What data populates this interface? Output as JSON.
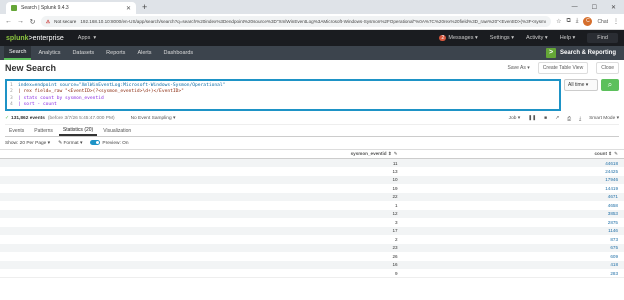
{
  "browser": {
    "tab_title": "Search | Splunk 9.4.3",
    "new_tab": "+",
    "security_warning": "Not secure",
    "url": "192.168.10.10:8000/en-US/app/search/search?q=search%20index%3Dendpoint%20source%3D\"XmlWinEventLog%3AMicrosoft-Windows-Sysmon%2FOperational\"%0A%7C%20rex%20field%3D_raw%20\"<EventID>(%3F<sysmon_eventid>%5...",
    "profile_initial": "C",
    "profile_label": "Chat"
  },
  "splunk_bar": {
    "logo_main": "splunk",
    "logo_sub": ">enterprise",
    "apps_label": "Apps",
    "messages": "Messages",
    "settings": "Settings",
    "activity": "Activity",
    "help": "Help",
    "find": "Find",
    "message_count": "2"
  },
  "app_bar": {
    "nav": [
      "Search",
      "Analytics",
      "Datasets",
      "Reports",
      "Alerts",
      "Dashboards"
    ],
    "active_index": 0,
    "app_name": "Search & Reporting"
  },
  "search": {
    "title": "New Search",
    "save_as": "Save As",
    "create_table_view": "Create Table View",
    "close": "Close",
    "lines": [
      {
        "num": "1",
        "text": "index=endpoint source=\"XmlWinEventLog:Microsoft-Windows-Sysmon/Operational\""
      },
      {
        "num": "2",
        "text": "| rex field=_raw \"<EventID>(?<sysmon_eventid>\\d+)</EventID>\""
      },
      {
        "num": "3",
        "text": "| stats count by sysmon_eventid"
      },
      {
        "num": "4",
        "text": "| sort - count"
      }
    ],
    "time_range": "All time",
    "status_events": "131,862 events",
    "status_time": "(before 3/7/26 5:45:47.000 PM)",
    "sampling": "No Event Sampling",
    "job": "Job",
    "smart_mode": "Smart Mode"
  },
  "result_tabs": [
    "Events",
    "Patterns",
    "Statistics (20)",
    "Visualization"
  ],
  "active_result_tab": 2,
  "options": {
    "per_page": "Show: 20 Per Page",
    "format": "Format",
    "preview": "Preview: On"
  },
  "table": {
    "headers": [
      "sysmon_eventid",
      "count"
    ],
    "rows": [
      [
        "11",
        "44618"
      ],
      [
        "13",
        "24425"
      ],
      [
        "10",
        "17946"
      ],
      [
        "19",
        "14419"
      ],
      [
        "22",
        "4671"
      ],
      [
        "1",
        "4658"
      ],
      [
        "12",
        "3853"
      ],
      [
        "3",
        "2875"
      ],
      [
        "17",
        "1146"
      ],
      [
        "2",
        "873"
      ],
      [
        "23",
        "675"
      ],
      [
        "26",
        "609"
      ],
      [
        "16",
        "418"
      ],
      [
        "9",
        "283"
      ]
    ]
  }
}
